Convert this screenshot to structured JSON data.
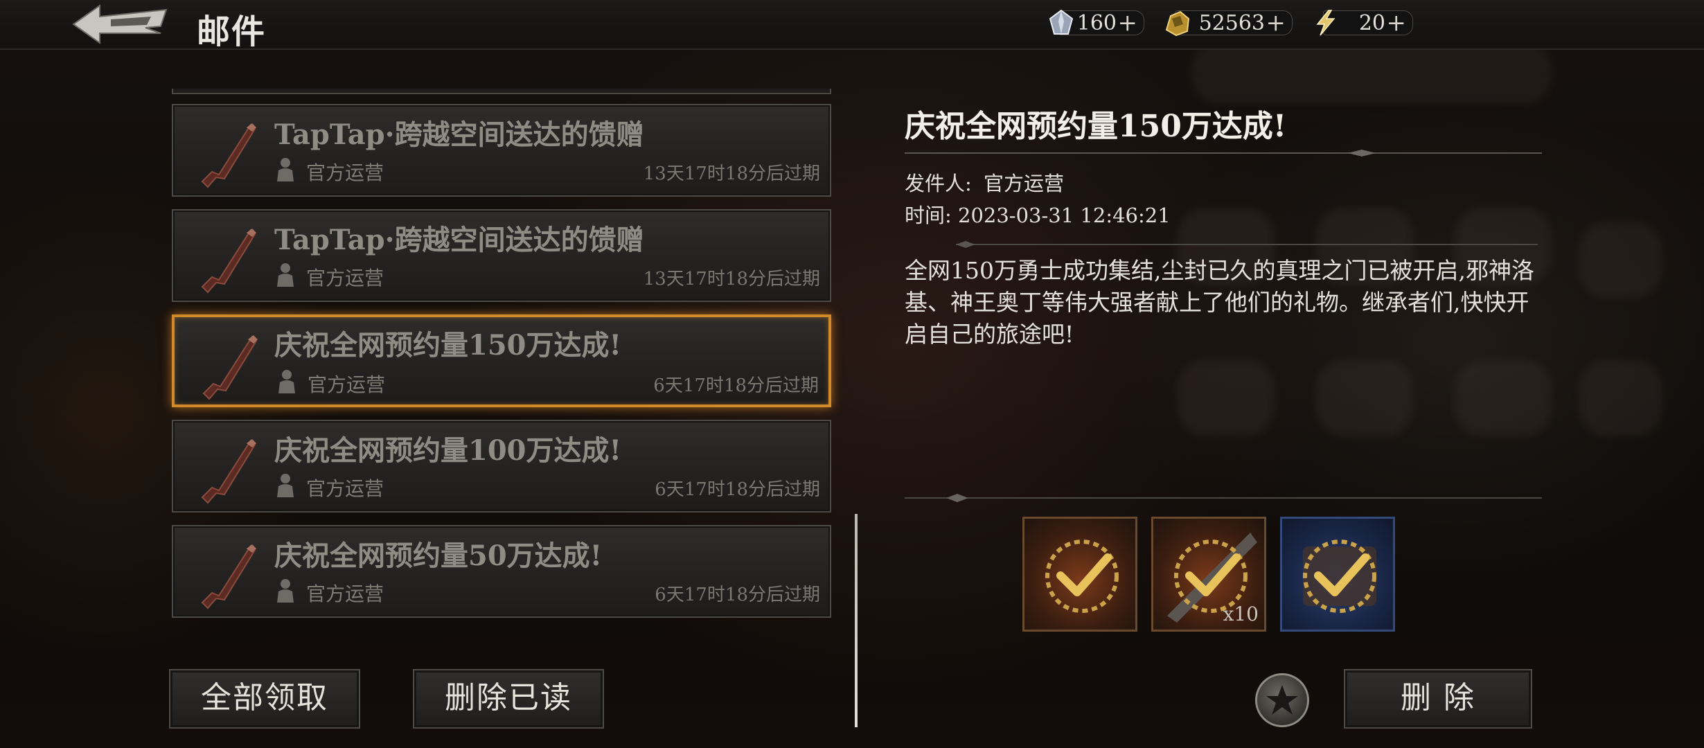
{
  "header": {
    "title": "邮件",
    "resources": [
      {
        "icon": "crystal-icon",
        "value": "160",
        "plus": "+"
      },
      {
        "icon": "gold-ore-icon",
        "value": "52563",
        "plus": "+"
      },
      {
        "icon": "lightning-icon",
        "value": "20",
        "plus": "+"
      }
    ]
  },
  "mail_list": {
    "items": [
      {
        "subject": "TapTap·跨越空间送达的馈赠",
        "sender": "官方运营",
        "expire": "13天17时18分后过期",
        "selected": false
      },
      {
        "subject": "TapTap·跨越空间送达的馈赠",
        "sender": "官方运营",
        "expire": "13天17时18分后过期",
        "selected": false
      },
      {
        "subject": "庆祝全网预约量150万达成!",
        "sender": "官方运营",
        "expire": "6天17时18分后过期",
        "selected": true
      },
      {
        "subject": "庆祝全网预约量100万达成!",
        "sender": "官方运营",
        "expire": "6天17时18分后过期",
        "selected": false
      },
      {
        "subject": "庆祝全网预约量50万达成!",
        "sender": "官方运营",
        "expire": "6天17时18分后过期",
        "selected": false
      }
    ]
  },
  "actions": {
    "claim_all": "全部领取",
    "delete_read": "删除已读",
    "delete": "删 除"
  },
  "detail": {
    "title": "庆祝全网预约量150万达成!",
    "sender_label": "发件人:",
    "sender": "官方运营",
    "time_label": "时间:",
    "time": "2023-03-31 12:46:21",
    "body": "全网150万勇士成功集结,尘封已久的真理之门已被开启,邪神洛基、神王奥丁等伟大强者献上了他们的礼物。继承者们,快快开启自己的旅途吧!",
    "rewards": [
      {
        "name": "reward-item-1",
        "quantity": "",
        "claimed": true
      },
      {
        "name": "reward-item-2",
        "quantity": "x10",
        "claimed": true
      },
      {
        "name": "reward-item-3",
        "quantity": "",
        "claimed": true
      }
    ]
  },
  "colors": {
    "selected_border": "#d08a2a",
    "claimed_check": "#e8c25a"
  }
}
